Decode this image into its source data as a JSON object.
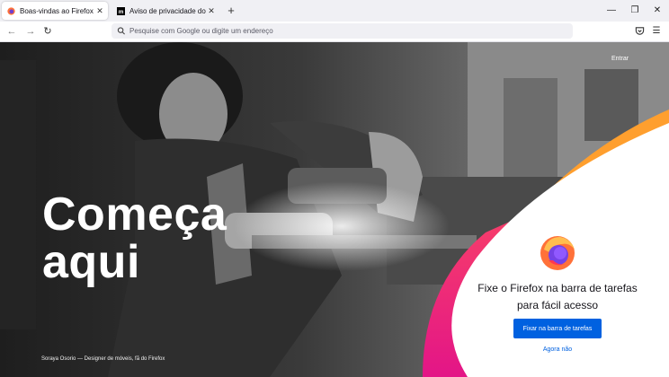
{
  "tabs": [
    {
      "title": "Boas-vindas ao Firefox",
      "icon": "firefox-icon",
      "active": true
    },
    {
      "title": "Aviso de privacidade do Firefox",
      "icon": "mozilla-icon",
      "active": false
    }
  ],
  "url_bar": {
    "placeholder": "Pesquise com Google ou digite um endereço",
    "value": ""
  },
  "page": {
    "headline_line1": "Começa",
    "headline_line2": "aqui",
    "photo_credit": "Soraya Osorio — Designer de móveis, fã do Firefox",
    "sign_in_link": "Entrar"
  },
  "promo": {
    "title": "Fixe o Firefox na barra de tarefas para fácil acesso",
    "primary_button": "Fixar na barra de tarefas",
    "secondary_link": "Agora não"
  },
  "colors": {
    "accent": "#0061e0",
    "pink": "#e31587",
    "orange": "#ff9f2e",
    "tab_strip": "#f0f0f4"
  }
}
